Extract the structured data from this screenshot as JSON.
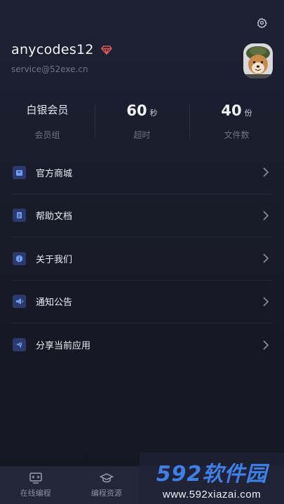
{
  "profile": {
    "username": "anycodes12",
    "email": "service@52exe.cn"
  },
  "stats": [
    {
      "value": "白银会员",
      "unit": "",
      "label": "会员组"
    },
    {
      "value": "60",
      "unit": "秒",
      "label": "超时"
    },
    {
      "value": "40",
      "unit": "份",
      "label": "文件数"
    }
  ],
  "menu": [
    {
      "label": "官方商城",
      "icon": "shop-icon"
    },
    {
      "label": "帮助文档",
      "icon": "document-icon"
    },
    {
      "label": "关于我们",
      "icon": "info-icon"
    },
    {
      "label": "通知公告",
      "icon": "megaphone-icon"
    },
    {
      "label": "分享当前应用",
      "icon": "send-icon"
    }
  ],
  "tabs": [
    {
      "label": "在线编程",
      "icon": "monitor-code-icon"
    },
    {
      "label": "编程资源",
      "icon": "graduation-cap-icon"
    }
  ],
  "watermark": {
    "logo": "592软件园",
    "url": "www.592xiazai.com"
  },
  "colors": {
    "accent": "#3f7fe8",
    "badge": "#e05a5a",
    "icon_bg": "#2b3a6b"
  }
}
